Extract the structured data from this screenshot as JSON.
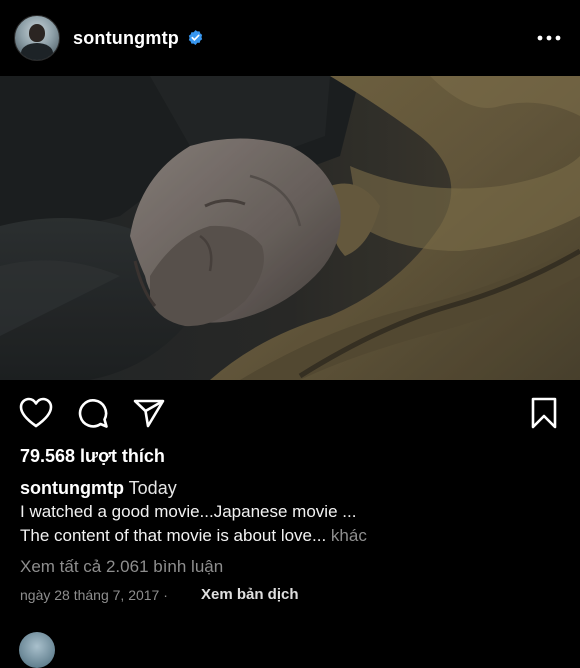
{
  "post": {
    "username": "sontungmtp",
    "verified": true,
    "more_icon": "more-horizontal-icon",
    "likes_text": "79.568 lượt thích",
    "caption_user": "sontungmtp",
    "caption_time": "Today",
    "caption_line1": "I watched a good movie...Japanese movie ...",
    "caption_line2": "The content of that movie is about love...",
    "caption_more": "khác",
    "view_comments": "Xem tất cả 2.061 bình luận",
    "date": "ngày 28 tháng 7, 2017",
    "dot": "·",
    "translate": "Xem bản dịch"
  },
  "actions": {
    "like": "heart-icon",
    "comment": "comment-icon",
    "share": "share-icon",
    "save": "bookmark-icon"
  },
  "colors": {
    "background": "#000000",
    "text": "#ffffff",
    "muted": "#8e8e8e",
    "verified": "#3897f0"
  }
}
